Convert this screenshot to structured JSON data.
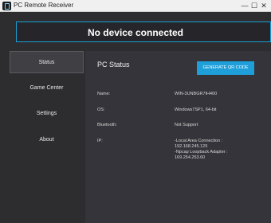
{
  "window": {
    "title": "PC Remote Receiver",
    "min_glyph": "—",
    "max_glyph": "☐",
    "close_glyph": "✕"
  },
  "banner": {
    "text": "No device connected"
  },
  "sidebar": {
    "items": [
      {
        "label": "Status",
        "active": true
      },
      {
        "label": "Game Center",
        "active": false
      },
      {
        "label": "Settings",
        "active": false
      },
      {
        "label": "About",
        "active": false
      }
    ]
  },
  "status": {
    "title": "PC Status",
    "qr_button": "GENERATE QR CODE",
    "rows": [
      {
        "label": "Name:",
        "value": "WIN-3UNBGR7IH400"
      },
      {
        "label": "OS:",
        "value": "Windows7SP1, 64-bit"
      },
      {
        "label": "Bluetooth:",
        "value": "Not Support"
      },
      {
        "label": "IP:",
        "value_lines": [
          "-Local Area Connection :",
          "192.168.245.129",
          "-Npcap Loopback Adapter :",
          "169.254.253.60"
        ]
      }
    ]
  },
  "colors": {
    "accent": "#1e9fd9",
    "background": "#2d2d30",
    "panel": "#34343a"
  }
}
